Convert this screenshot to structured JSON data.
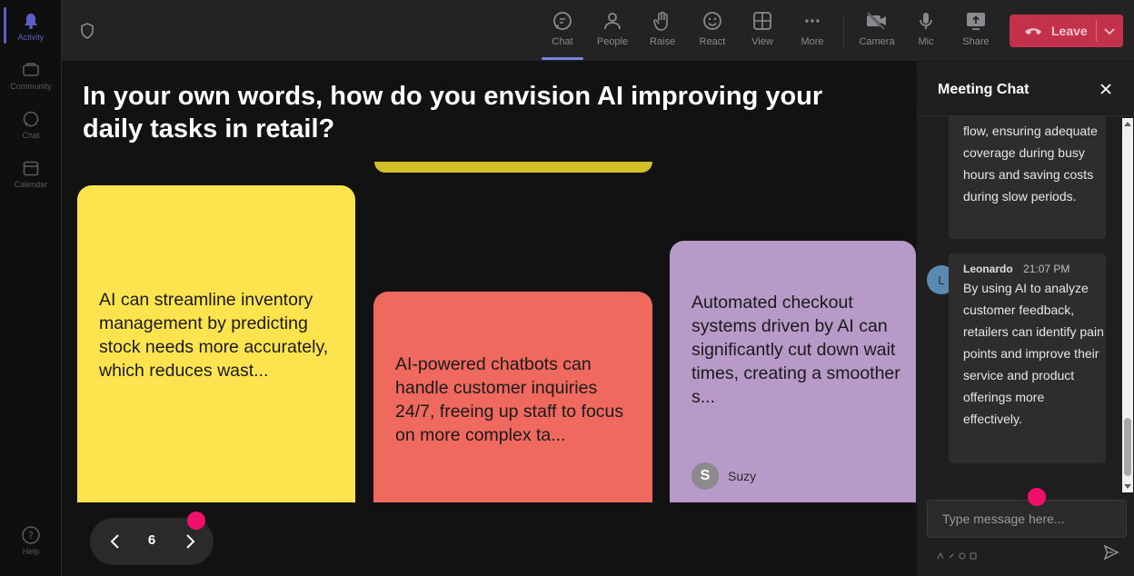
{
  "rail": {
    "items": [
      {
        "label": "Activity",
        "icon": "bell-icon"
      },
      {
        "label": "Community",
        "icon": "community-icon"
      },
      {
        "label": "Chat",
        "icon": "chat-icon"
      },
      {
        "label": "Calendar",
        "icon": "calendar-icon"
      },
      {
        "label": "Help",
        "icon": "help-icon"
      }
    ]
  },
  "toolbar": {
    "chat": "Chat",
    "people": "People",
    "raise": "Raise",
    "react": "React",
    "view": "View",
    "more": "More",
    "camera": "Camera",
    "mic": "Mic",
    "share": "Share",
    "leave": "Leave"
  },
  "stage": {
    "question": "In your own words, how do you envision AI improving your daily tasks in retail?",
    "cards": [
      {
        "text": "AI can streamline inventory management by predicting stock needs more accurately, which reduces wast...",
        "color": "#fde44f"
      },
      {
        "text": "AI-powered chatbots can handle customer inquiries 24/7, freeing up staff to focus on more complex ta...",
        "color": "#f0695e"
      },
      {
        "text": "Automated checkout systems driven by AI can significantly cut down wait times, creating a smoother s...",
        "color": "#b89ac8",
        "author_initial": "S",
        "author": "Suzy"
      }
    ],
    "page_number": "6"
  },
  "chat": {
    "title": "Meeting Chat",
    "messages": [
      {
        "text": "flow, ensuring adequate coverage during busy hours and saving costs during slow periods."
      },
      {
        "author": "Leonardo",
        "initial": "L",
        "time": "21:07 PM",
        "text": "By using AI to analyze customer feedback, retailers can identify pain points and improve their service and product offerings more effectively."
      }
    ],
    "compose_placeholder": "Type message here..."
  },
  "colors": {
    "accent": "#7b80e6",
    "leave": "#c4314b",
    "marker": "#f0106b"
  }
}
